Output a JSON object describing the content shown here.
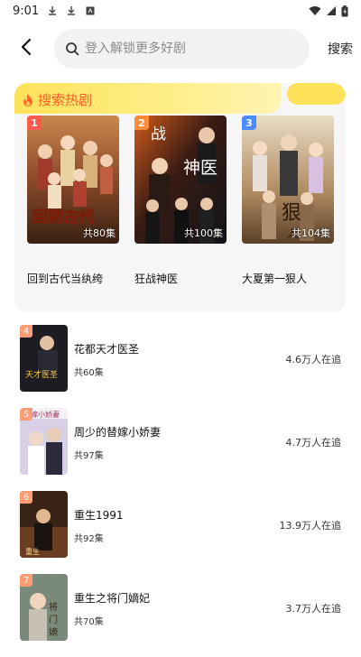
{
  "status": {
    "time": "9:01"
  },
  "search": {
    "placeholder": "登入解锁更多好剧",
    "button_label": "搜索"
  },
  "hot": {
    "title": "搜索热剧",
    "top": [
      {
        "rank": "1",
        "name": "回到古代当纨绔",
        "episodes": "共80集",
        "rank_color": "#ff5a4c"
      },
      {
        "rank": "2",
        "name": "狂战神医",
        "episodes": "共100集",
        "rank_color": "#ff8a3a"
      },
      {
        "rank": "3",
        "name": "大夏第一狠人",
        "episodes": "共104集",
        "rank_color": "#4a8cff"
      }
    ],
    "list": [
      {
        "rank": "4",
        "name": "花都天才医圣",
        "episodes": "共60集",
        "watching": "4.6万人在追"
      },
      {
        "rank": "5",
        "name": "周少的替嫁小娇妻",
        "episodes": "共97集",
        "watching": "4.7万人在追"
      },
      {
        "rank": "6",
        "name": "重生1991",
        "episodes": "共92集",
        "watching": "13.9万人在追"
      },
      {
        "rank": "7",
        "name": "重生之将门嫡妃",
        "episodes": "共70集",
        "watching": "3.7万人在追"
      }
    ]
  }
}
